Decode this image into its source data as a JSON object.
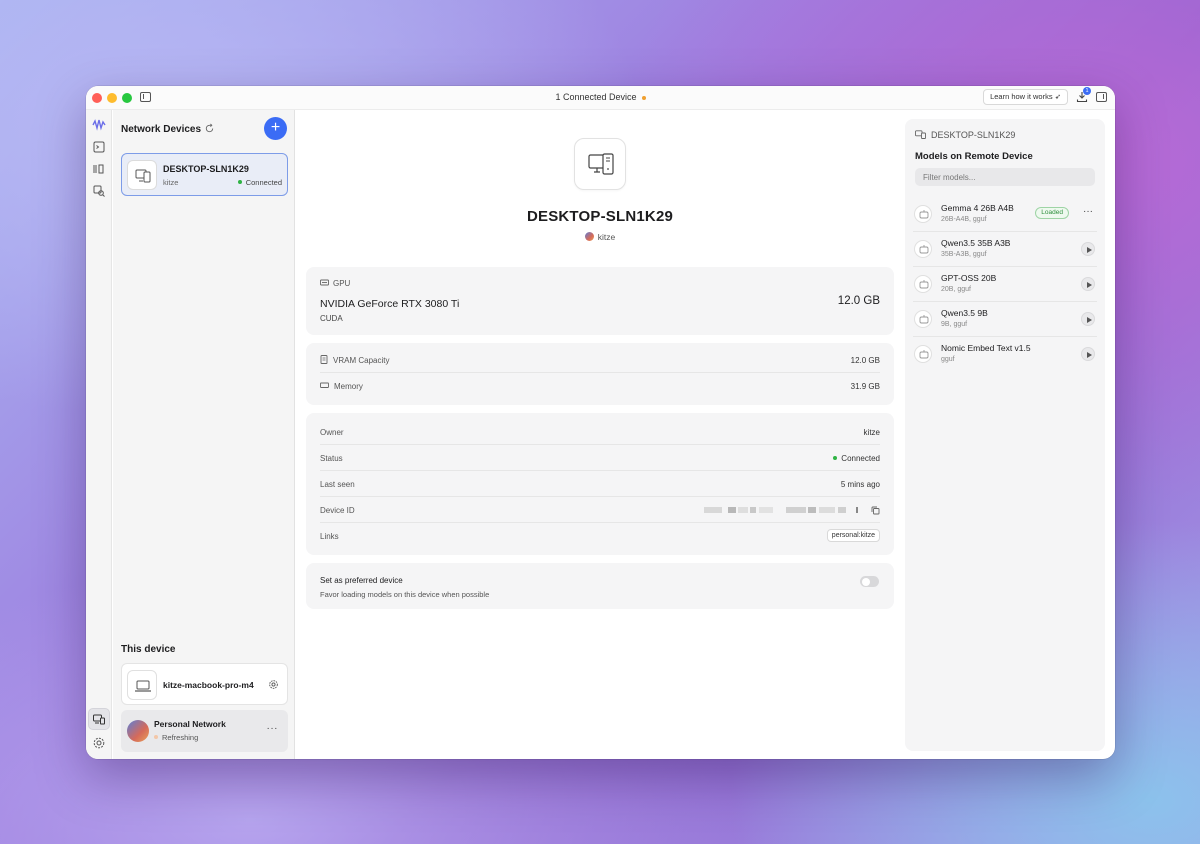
{
  "titlebar": {
    "title": "1 Connected Device",
    "learn_label": "Learn how it works",
    "download_badge": "1"
  },
  "devices": {
    "title": "Network Devices",
    "add_label": "+",
    "items": [
      {
        "name": "DESKTOP-SLN1K29",
        "user": "kitze",
        "status": "Connected"
      }
    ]
  },
  "this_device": {
    "title": "This device",
    "name": "kitze-macbook-pro-m4"
  },
  "network": {
    "name": "Personal Network",
    "status": "Refreshing",
    "more_label": "···"
  },
  "detail": {
    "name": "DESKTOP-SLN1K29",
    "owner": "kitze",
    "gpu": {
      "section_label": "GPU",
      "name": "NVIDIA GeForce RTX 3080 Ti",
      "backend": "CUDA",
      "memory": "12.0 GB"
    },
    "specs": [
      {
        "label": "VRAM Capacity",
        "value": "12.0 GB"
      },
      {
        "label": "Memory",
        "value": "31.9 GB"
      }
    ],
    "info": {
      "owner_label": "Owner",
      "owner_value": "kitze",
      "status_label": "Status",
      "status_value": "Connected",
      "last_seen_label": "Last seen",
      "last_seen_value": "5 mins ago",
      "device_id_label": "Device ID",
      "links_label": "Links",
      "links_value": "personal:kitze"
    },
    "preferred": {
      "title": "Set as preferred device",
      "subtitle": "Favor loading models on this device when possible",
      "enabled": false
    }
  },
  "remote": {
    "host": "DESKTOP-SLN1K29",
    "title": "Models on Remote Device",
    "filter_placeholder": "Filter models...",
    "loaded_label": "Loaded",
    "more_label": "···",
    "models": [
      {
        "name": "Gemma 4 26B A4B",
        "meta": "26B-A4B, gguf",
        "loaded": true
      },
      {
        "name": "Qwen3.5 35B A3B",
        "meta": "35B-A3B, gguf",
        "loaded": false
      },
      {
        "name": "GPT-OSS 20B",
        "meta": "20B, gguf",
        "loaded": false
      },
      {
        "name": "Qwen3.5 9B",
        "meta": "9B, gguf",
        "loaded": false
      },
      {
        "name": "Nomic Embed Text v1.5",
        "meta": "gguf",
        "loaded": false
      }
    ]
  },
  "colors": {
    "accent": "#3b6cf5",
    "connected": "#2fb344",
    "refreshing": "#f3c7a8",
    "loaded": "#2f8f3e"
  }
}
